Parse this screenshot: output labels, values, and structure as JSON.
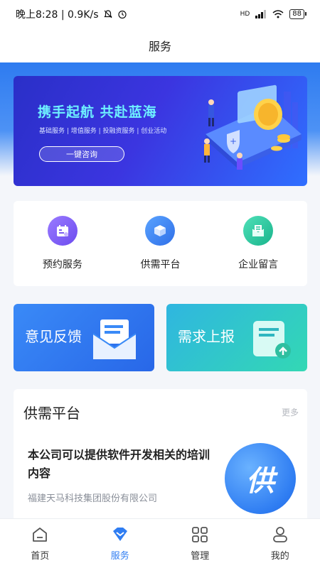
{
  "status_bar": {
    "time_speed": "晚上8:28 | 0.9K/s",
    "signal_label": "HD",
    "battery": "88"
  },
  "header": {
    "title": "服务"
  },
  "banner": {
    "headline": "携手起航  共赴蓝海",
    "subline": "基础服务 | 增值服务 | 投融资服务 | 创业活动",
    "button": "一键咨询"
  },
  "quick_actions": [
    {
      "label": "预约服务",
      "icon": "calendar-icon",
      "color": "#7b5cf0"
    },
    {
      "label": "供需平台",
      "icon": "cube-icon",
      "color": "#2f7df2"
    },
    {
      "label": "企业留言",
      "icon": "mail-icon",
      "color": "#21c29a"
    }
  ],
  "cards": {
    "feedback": "意见反馈",
    "report": "需求上报"
  },
  "supply": {
    "title": "供需平台",
    "more": "更多",
    "post": {
      "title": "本公司可以提供软件开发相关的培训内容",
      "company": "福建天马科技集团股份有限公司",
      "badge": "供"
    }
  },
  "tabbar": {
    "items": [
      {
        "label": "首页",
        "icon": "home-icon"
      },
      {
        "label": "服务",
        "icon": "service-icon"
      },
      {
        "label": "管理",
        "icon": "grid-icon"
      },
      {
        "label": "我的",
        "icon": "profile-icon"
      }
    ],
    "active": "服务",
    "active_color": "#2f7df2"
  }
}
